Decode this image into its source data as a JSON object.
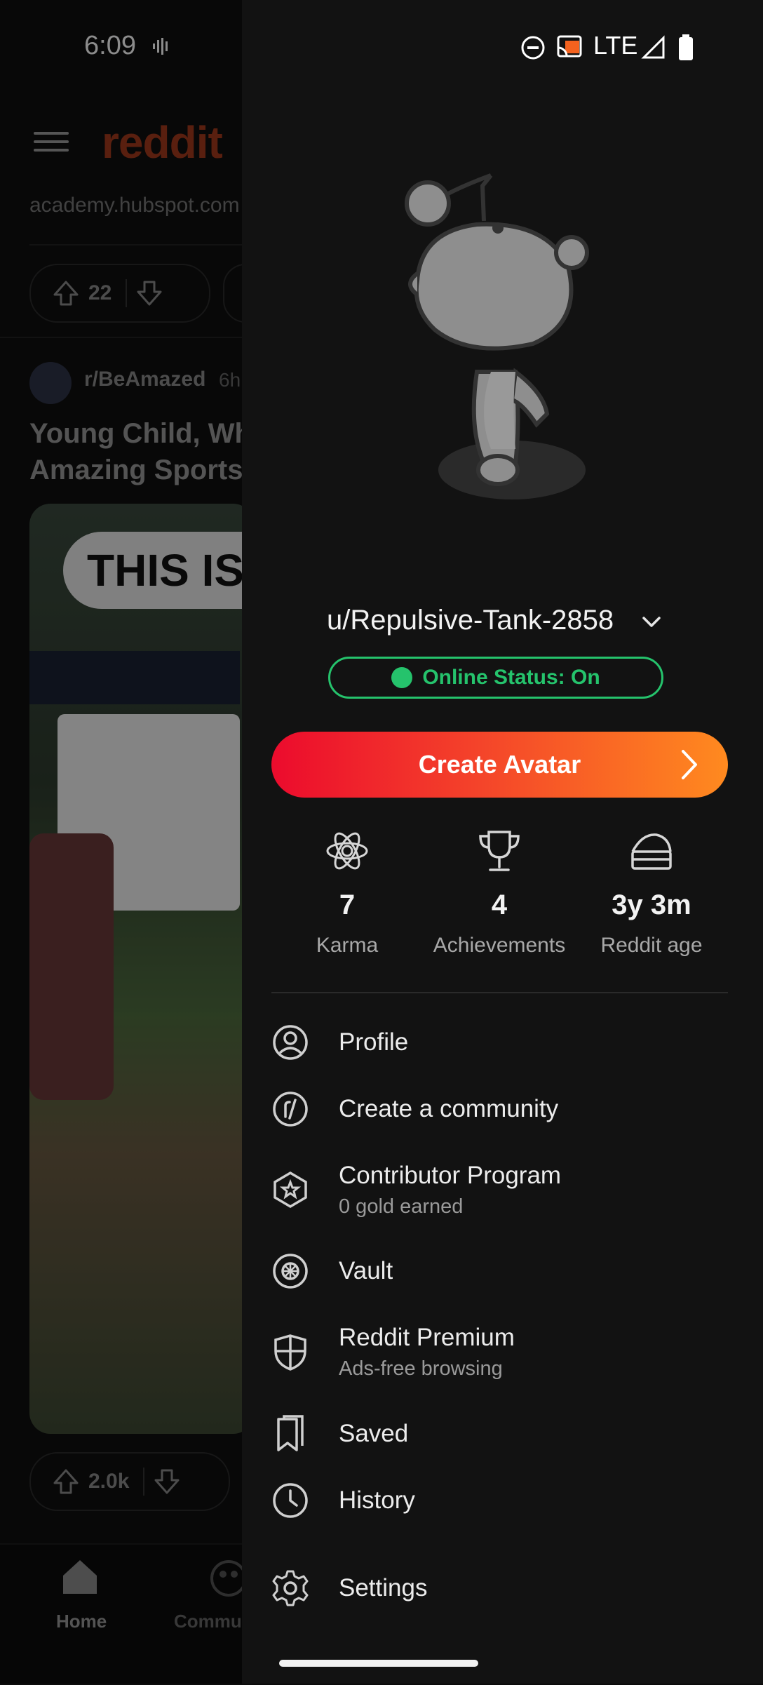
{
  "status_bar": {
    "time": "6:09",
    "network": "LTE"
  },
  "feed": {
    "brand": "reddit",
    "ad_url": "academy.hubspot.com",
    "top_vote_count": "22",
    "subreddit": "r/BeAmazed",
    "post_age": "6h",
    "post_title_line1": "Young Child, Wh",
    "post_title_line2": "Amazing Sports",
    "video_caption": "THIS IS",
    "video_vote_count": "2.0k",
    "nav_home": "Home",
    "nav_communities": "Commun"
  },
  "drawer": {
    "username": "u/Repulsive-Tank-2858",
    "online_status": "Online Status: On",
    "create_avatar": "Create Avatar",
    "stats": [
      {
        "value": "7",
        "label": "Karma",
        "icon": "karma-icon"
      },
      {
        "value": "4",
        "label": "Achievements",
        "icon": "trophy-icon"
      },
      {
        "value": "3y 3m",
        "label": "Reddit age",
        "icon": "cake-icon"
      }
    ],
    "menu": [
      {
        "label": "Profile",
        "icon": "profile-icon"
      },
      {
        "label": "Create a community",
        "icon": "community-icon"
      },
      {
        "label": "Contributor Program",
        "sub": "0 gold earned",
        "icon": "contributor-icon"
      },
      {
        "label": "Vault",
        "icon": "vault-icon"
      },
      {
        "label": "Reddit Premium",
        "sub": "Ads-free browsing",
        "icon": "premium-icon"
      },
      {
        "label": "Saved",
        "icon": "saved-icon"
      },
      {
        "label": "History",
        "icon": "history-icon"
      },
      {
        "label": "Settings",
        "icon": "settings-icon"
      }
    ]
  },
  "colors": {
    "online": "#25c36c",
    "avatar_gradient_start": "#ec0b2d",
    "avatar_gradient_end": "#ff8a1f"
  }
}
